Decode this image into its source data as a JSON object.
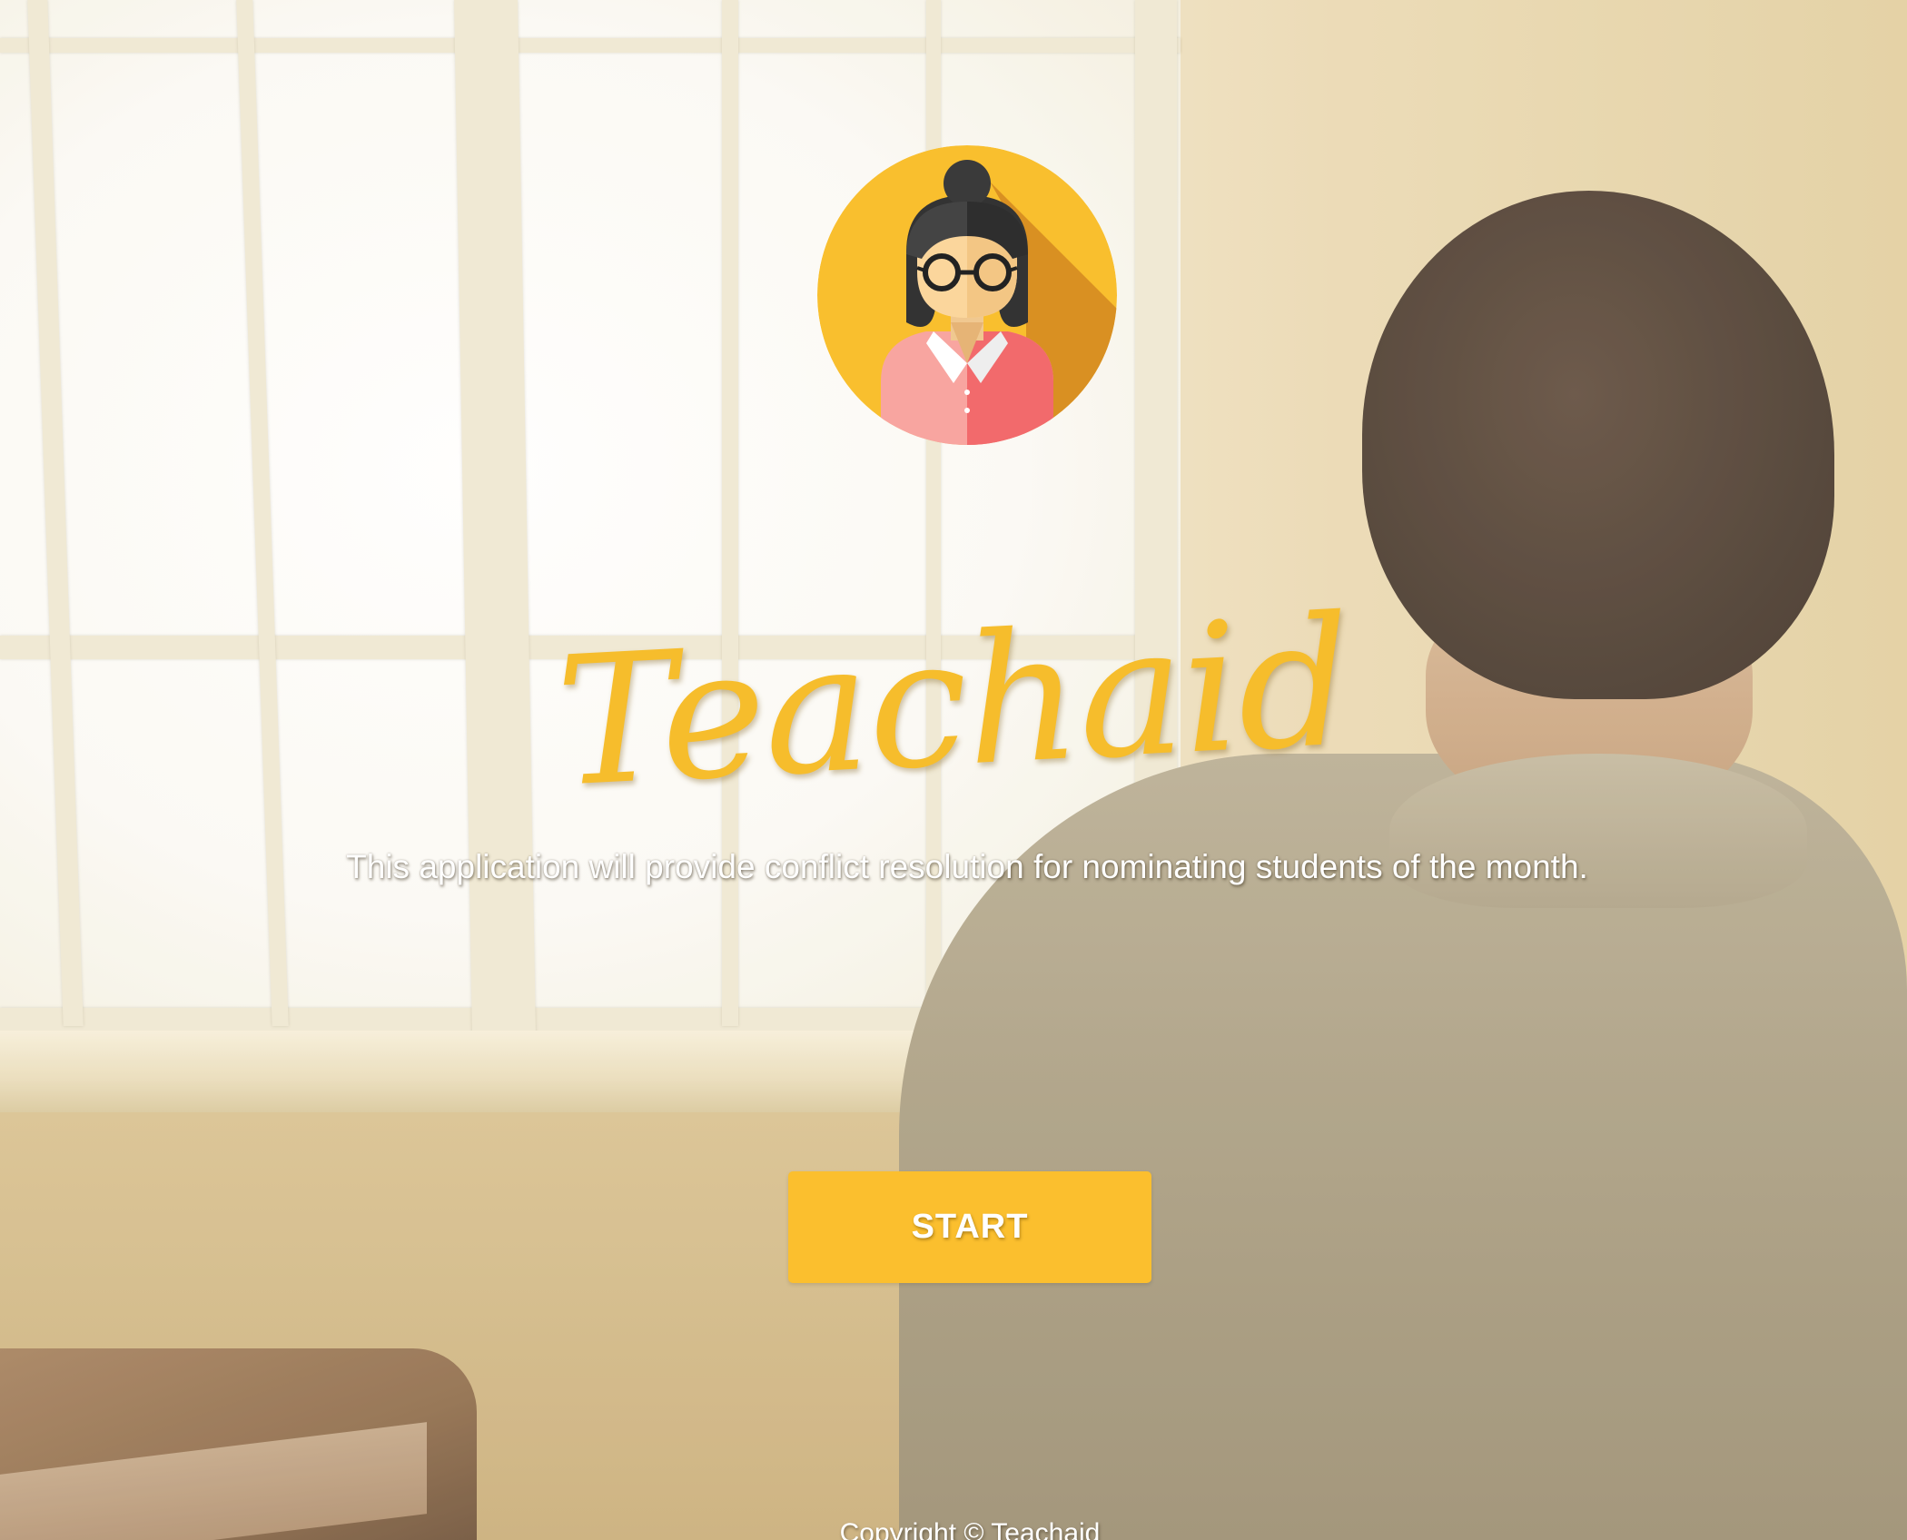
{
  "app": {
    "title": "Teachaid",
    "tagline": "This application will provide conflict resolution for nominating students of the month."
  },
  "logo": {
    "icon": "teacher-avatar-icon"
  },
  "actions": {
    "start_label": "START"
  },
  "footer": {
    "copyright": "Copyright © Teachaid"
  },
  "colors": {
    "accent": "#fbbf2e",
    "title": "#f6bd2c",
    "avatar_bg": "#f9bf2e",
    "avatar_shadow": "#d99022",
    "shirt_light": "#f8a5a0",
    "shirt_dark": "#f26a6c"
  }
}
